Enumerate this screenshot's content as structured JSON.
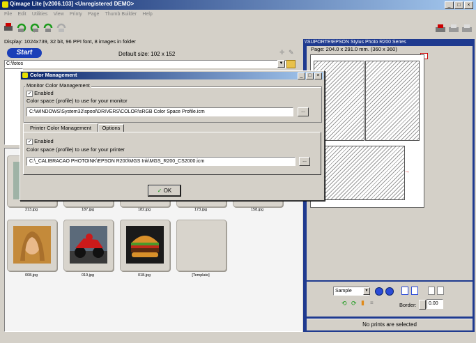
{
  "window": {
    "title": "Qimage Lite [v2006.103] <Unregistered DEMO>",
    "controls": [
      "_",
      "□",
      "×"
    ]
  },
  "menu": [
    "File",
    "Edit",
    "Utilities",
    "View",
    "Printy",
    "Page",
    "Thumb Builder",
    "Help"
  ],
  "status_display": "Display: 1024x739, 32 bit, 96 PPI font, 8 images in folder",
  "start_label": "Start",
  "default_size": "Default size: 102 x 152",
  "folder_path": "C:\\fotos",
  "thumbs_row1": [
    "213.jpg",
    "187.jpg",
    "182.jpg",
    "173.jpg",
    "158.jpg"
  ],
  "thumbs_row2": [
    "008.jpg",
    "019.jpg",
    "018.jpg",
    "[Template]"
  ],
  "dialog": {
    "title": "Color Management",
    "controls": [
      "_",
      "□",
      "×"
    ],
    "monitor_group": "Monitor Color Management",
    "monitor_enabled_mark": "✓",
    "monitor_enabled": "Enabled",
    "monitor_desc": "Color space (profile) to use for your monitor",
    "monitor_path": "C:\\WINDOWS\\System32\\spool\\DRIVERS\\COLOR\\sRGB Color Space Profile.icm",
    "browse": "...",
    "tab_printer": "Printer Color Management",
    "tab_options": "Options",
    "printer_enabled_mark": "✓",
    "printer_enabled": "Enabled",
    "printer_desc": "Color space (profile) to use for your printer",
    "printer_path": "C:\\_CALIBRACAO PHOTOINK\\EPSON R200\\MGS Ink\\MGS_R200_CS2000.icm",
    "ok": "OK",
    "ok_mark": "✓"
  },
  "printer": {
    "name": "\\\\SUPORTE\\EPSON Stylus Photo R200 Series",
    "page": "Page: 204.0 x 291.0 mm.  (360 x 360)"
  },
  "bottom_controls": {
    "sample": "Sample",
    "border_label": "Border:",
    "border_value": "0.00"
  },
  "status_bar": "No prints are selected",
  "colors": {
    "titlebar_start": "#0a246a",
    "titlebar_end": "#a6caf0",
    "panel_blue": "#1f3a8f",
    "start_button": "#1b3fb8"
  }
}
